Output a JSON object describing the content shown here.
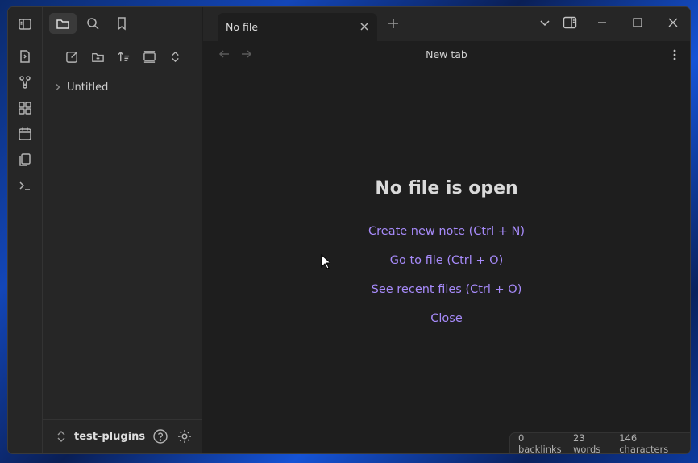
{
  "tab": {
    "title": "No file"
  },
  "navbar": {
    "title": "New tab"
  },
  "file_tree": {
    "items": [
      {
        "label": "Untitled"
      }
    ]
  },
  "vault": {
    "name": "test-plugins"
  },
  "empty_state": {
    "title": "No file is open",
    "actions": [
      {
        "label": "Create new note (Ctrl + N)"
      },
      {
        "label": "Go to file (Ctrl + O)"
      },
      {
        "label": "See recent files (Ctrl + O)"
      },
      {
        "label": "Close"
      }
    ]
  },
  "status": {
    "backlinks": "0 backlinks",
    "words": "23 words",
    "characters": "146 characters"
  },
  "colors": {
    "accent": "#a68af9",
    "background": "#1e1e1e",
    "panel": "#262626"
  },
  "icons": {
    "ribbon": [
      "open-quick-switcher-icon",
      "graph-view-icon",
      "canvas-icon",
      "daily-note-icon",
      "templates-icon",
      "command-palette-icon"
    ],
    "sidebar_tabs": [
      "sidebar-toggle-icon",
      "folder-icon",
      "search-icon",
      "bookmark-icon"
    ],
    "file_tools": [
      "new-note-icon",
      "new-folder-icon",
      "sort-icon",
      "collapse-view-icon",
      "expand-collapse-icon"
    ]
  }
}
